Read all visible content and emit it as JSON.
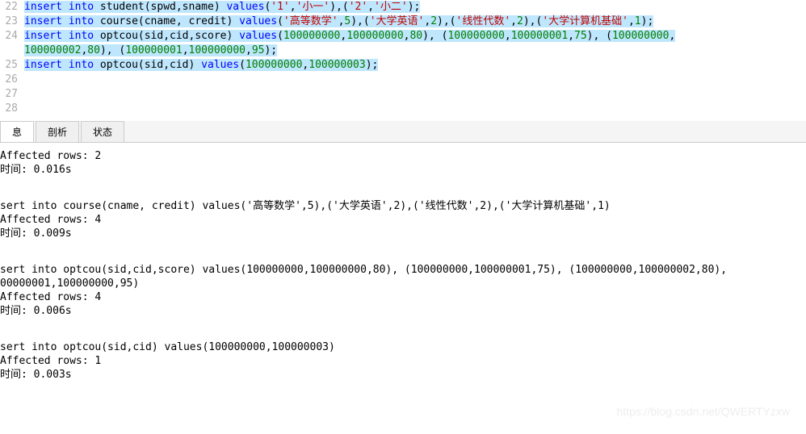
{
  "editor": {
    "lines": [
      {
        "num": "22",
        "selected": true,
        "tokens": [
          {
            "t": "kw",
            "v": "insert"
          },
          {
            "t": "id",
            "v": " "
          },
          {
            "t": "kw",
            "v": "into"
          },
          {
            "t": "id",
            "v": " student(spwd,sname) "
          },
          {
            "t": "kw",
            "v": "values"
          },
          {
            "t": "id",
            "v": "("
          },
          {
            "t": "str",
            "v": "'1'"
          },
          {
            "t": "id",
            "v": ","
          },
          {
            "t": "str",
            "v": "'小一'"
          },
          {
            "t": "id",
            "v": "),("
          },
          {
            "t": "str",
            "v": "'2'"
          },
          {
            "t": "id",
            "v": ","
          },
          {
            "t": "str",
            "v": "'小二'"
          },
          {
            "t": "id",
            "v": ");"
          }
        ]
      },
      {
        "num": "23",
        "selected": true,
        "tokens": [
          {
            "t": "kw",
            "v": "insert"
          },
          {
            "t": "id",
            "v": " "
          },
          {
            "t": "kw",
            "v": "into"
          },
          {
            "t": "id",
            "v": " course(cname, credit) "
          },
          {
            "t": "kw",
            "v": "values"
          },
          {
            "t": "id",
            "v": "("
          },
          {
            "t": "str",
            "v": "'高等数学'"
          },
          {
            "t": "id",
            "v": ","
          },
          {
            "t": "num",
            "v": "5"
          },
          {
            "t": "id",
            "v": "),("
          },
          {
            "t": "str",
            "v": "'大学英语'"
          },
          {
            "t": "id",
            "v": ","
          },
          {
            "t": "num",
            "v": "2"
          },
          {
            "t": "id",
            "v": "),("
          },
          {
            "t": "str",
            "v": "'线性代数'"
          },
          {
            "t": "id",
            "v": ","
          },
          {
            "t": "num",
            "v": "2"
          },
          {
            "t": "id",
            "v": "),("
          },
          {
            "t": "str",
            "v": "'大学计算机基础'"
          },
          {
            "t": "id",
            "v": ","
          },
          {
            "t": "num",
            "v": "1"
          },
          {
            "t": "id",
            "v": ");"
          }
        ]
      },
      {
        "num": "24",
        "selected": true,
        "tokens": [
          {
            "t": "kw",
            "v": "insert"
          },
          {
            "t": "id",
            "v": " "
          },
          {
            "t": "kw",
            "v": "into"
          },
          {
            "t": "id",
            "v": " optcou(sid,cid,score) "
          },
          {
            "t": "kw",
            "v": "values"
          },
          {
            "t": "id",
            "v": "("
          },
          {
            "t": "num",
            "v": "100000000"
          },
          {
            "t": "id",
            "v": ","
          },
          {
            "t": "num",
            "v": "100000000"
          },
          {
            "t": "id",
            "v": ","
          },
          {
            "t": "num",
            "v": "80"
          },
          {
            "t": "id",
            "v": "), ("
          },
          {
            "t": "num",
            "v": "100000000"
          },
          {
            "t": "id",
            "v": ","
          },
          {
            "t": "num",
            "v": "100000001"
          },
          {
            "t": "id",
            "v": ","
          },
          {
            "t": "num",
            "v": "75"
          },
          {
            "t": "id",
            "v": "), ("
          },
          {
            "t": "num",
            "v": "100000000"
          },
          {
            "t": "id",
            "v": ","
          }
        ]
      },
      {
        "num": "",
        "selected": true,
        "tokens": [
          {
            "t": "num",
            "v": "100000002"
          },
          {
            "t": "id",
            "v": ","
          },
          {
            "t": "num",
            "v": "80"
          },
          {
            "t": "id",
            "v": "), ("
          },
          {
            "t": "num",
            "v": "100000001"
          },
          {
            "t": "id",
            "v": ","
          },
          {
            "t": "num",
            "v": "100000000"
          },
          {
            "t": "id",
            "v": ","
          },
          {
            "t": "num",
            "v": "95"
          },
          {
            "t": "id",
            "v": ");"
          }
        ]
      },
      {
        "num": "25",
        "selected": true,
        "tokens": [
          {
            "t": "kw",
            "v": "insert"
          },
          {
            "t": "id",
            "v": " "
          },
          {
            "t": "kw",
            "v": "into"
          },
          {
            "t": "id",
            "v": " optcou(sid,cid) "
          },
          {
            "t": "kw",
            "v": "values"
          },
          {
            "t": "id",
            "v": "("
          },
          {
            "t": "num",
            "v": "100000000"
          },
          {
            "t": "id",
            "v": ","
          },
          {
            "t": "num",
            "v": "100000003"
          },
          {
            "t": "id",
            "v": ");"
          }
        ]
      },
      {
        "num": "26",
        "selected": false,
        "tokens": []
      },
      {
        "num": "27",
        "selected": false,
        "tokens": []
      },
      {
        "num": "28",
        "selected": false,
        "tokens": []
      }
    ]
  },
  "tabs": {
    "t0": "息",
    "t1": "剖析",
    "t2": "状态"
  },
  "results": {
    "b0": {
      "l0": "Affected rows: 2",
      "l1": "时间: 0.016s"
    },
    "b1": {
      "l0": "sert into course(cname, credit) values('高等数学',5),('大学英语',2),('线性代数',2),('大学计算机基础',1)",
      "l1": "Affected rows: 4",
      "l2": "时间: 0.009s"
    },
    "b2": {
      "l0": "sert into optcou(sid,cid,score) values(100000000,100000000,80), (100000000,100000001,75), (100000000,100000002,80), ",
      "l0b": "00000001,100000000,95)",
      "l1": "Affected rows: 4",
      "l2": "时间: 0.006s"
    },
    "b3": {
      "l0": "sert into optcou(sid,cid) values(100000000,100000003)",
      "l1": "Affected rows: 1",
      "l2": "时间: 0.003s"
    }
  },
  "watermark": "https://blog.csdn.net/QWERTYzxw"
}
